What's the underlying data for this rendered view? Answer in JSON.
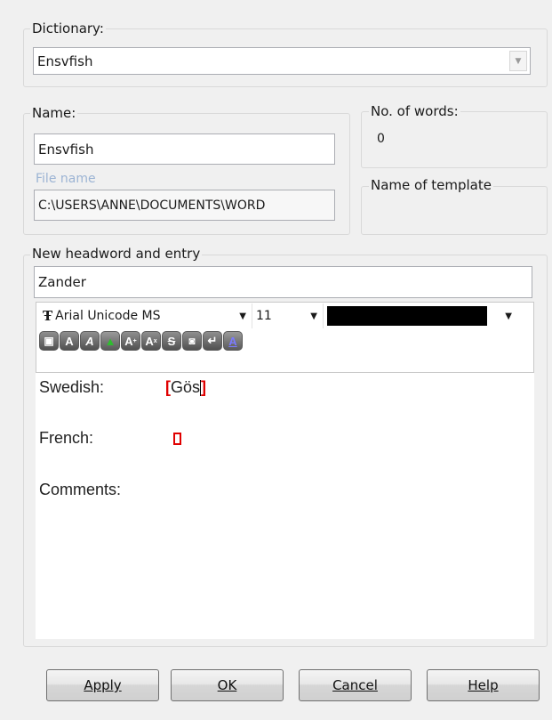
{
  "dictionary": {
    "label": "Dictionary:",
    "selected": "Ensvfish",
    "dropdown_icon": "chevron-down-icon"
  },
  "name": {
    "label": "Name:",
    "value": "Ensvfish",
    "file_label": "File name",
    "file_value": "C:\\USERS\\ANNE\\DOCUMENTS\\WORD"
  },
  "words": {
    "label": "No. of words:",
    "value": "0"
  },
  "template": {
    "label": "Name of template"
  },
  "entry": {
    "label": "New headword and entry",
    "headword": "Zander",
    "font_name": "Arial Unicode MS",
    "font_icon": "truetype-font-icon",
    "font_size": "11",
    "color_value": "#000000",
    "format_buttons": [
      {
        "name": "paste-icon",
        "glyph": "▣"
      },
      {
        "name": "bold-icon",
        "glyph": "A"
      },
      {
        "name": "italic-icon",
        "glyph": "A"
      },
      {
        "name": "highlight-icon",
        "glyph": "▲"
      },
      {
        "name": "superscript-icon",
        "glyph": "A"
      },
      {
        "name": "subscript-icon",
        "glyph": "A"
      },
      {
        "name": "strikethrough-icon",
        "glyph": "S"
      },
      {
        "name": "image-icon",
        "glyph": "◙"
      },
      {
        "name": "line-break-icon",
        "glyph": "↵"
      },
      {
        "name": "text-color-icon",
        "glyph": "A"
      }
    ],
    "body": {
      "swedish_label": "Swedish:",
      "swedish_value": "Gös",
      "bracket_open": "[",
      "bracket_close": "]",
      "french_label": "French:",
      "comments_label": "Comments:"
    }
  },
  "buttons": {
    "apply": "Apply",
    "ok": "OK",
    "cancel": "Cancel",
    "help": "Help"
  }
}
